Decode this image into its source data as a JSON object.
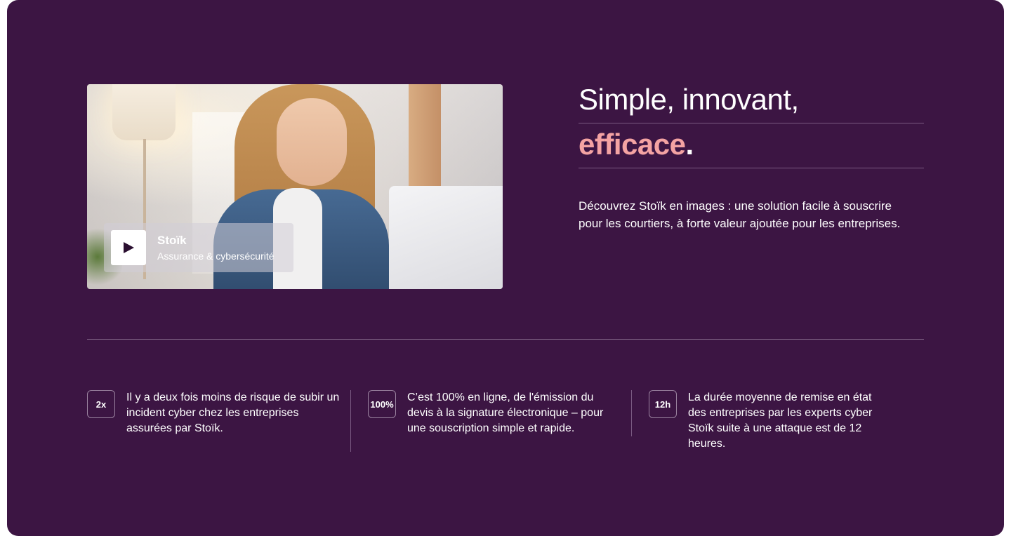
{
  "video": {
    "title": "Stoïk",
    "subtitle": "Assurance & cybersécurité",
    "play_icon": "play-icon"
  },
  "heading": {
    "line1": "Simple, innovant,",
    "accent_word": "efficace",
    "punctuation": "."
  },
  "description": "Découvrez Stoïk en images : une solution facile à souscrire pour les courtiers, à forte valeur ajoutée pour les entreprises.",
  "stats": [
    {
      "badge": "2x",
      "text": "Il y a deux fois moins de risque de subir un incident cyber chez les entreprises assurées par Stoïk."
    },
    {
      "badge": "100%",
      "text": "C’est 100% en ligne, de l'émission du devis à la signature électronique – pour une souscription simple et rapide."
    },
    {
      "badge": "12h",
      "text": "La durée moyenne de remise en état des entreprises par les experts cyber Stoïk suite à une attaque est de 12 heures."
    }
  ],
  "colors": {
    "background": "#3c1543",
    "accent": "#f4a3a3",
    "text": "#ffffff"
  }
}
